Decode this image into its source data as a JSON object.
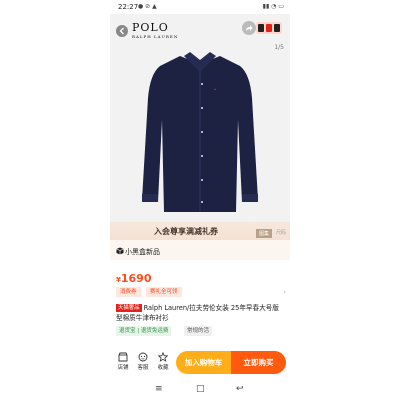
{
  "status_bar": {
    "time": "22:27",
    "left_icons": "● ⊘ ▲",
    "right_icons": "▮▮ ◔ ▭"
  },
  "header": {
    "logo_text": "POLO",
    "logo_subtext": "RALPH LAUREN",
    "image_counter": "1/5"
  },
  "promo": {
    "text": "入会尊享满减礼券",
    "tabs": [
      "图集",
      "尺码"
    ]
  },
  "store": {
    "label": "小黑盒新品"
  },
  "price": {
    "currency": "¥",
    "value": "1690"
  },
  "coupons": [
    "消费券",
    "赛礼全可领"
  ],
  "product": {
    "store_badge": "天猫奢品",
    "title": "Ralph Lauren/拉夫劳伦女装 25年早春大号版型棉质牛津布衬衫"
  },
  "service_tags": [
    "退货宝 | 退货免运费",
    "常规的活"
  ],
  "bottom_nav": {
    "items": [
      {
        "label": "店铺",
        "icon": "store-icon"
      },
      {
        "label": "客服",
        "icon": "customer-service-icon"
      },
      {
        "label": "收藏",
        "icon": "star-icon"
      }
    ],
    "add_to_cart": "加入购物车",
    "buy_now": "立即购买"
  },
  "colors": {
    "accent": "#ff5a0e",
    "cart": "#ffae1a",
    "price": "#ff4a1e",
    "shirt": "#1d2142"
  }
}
